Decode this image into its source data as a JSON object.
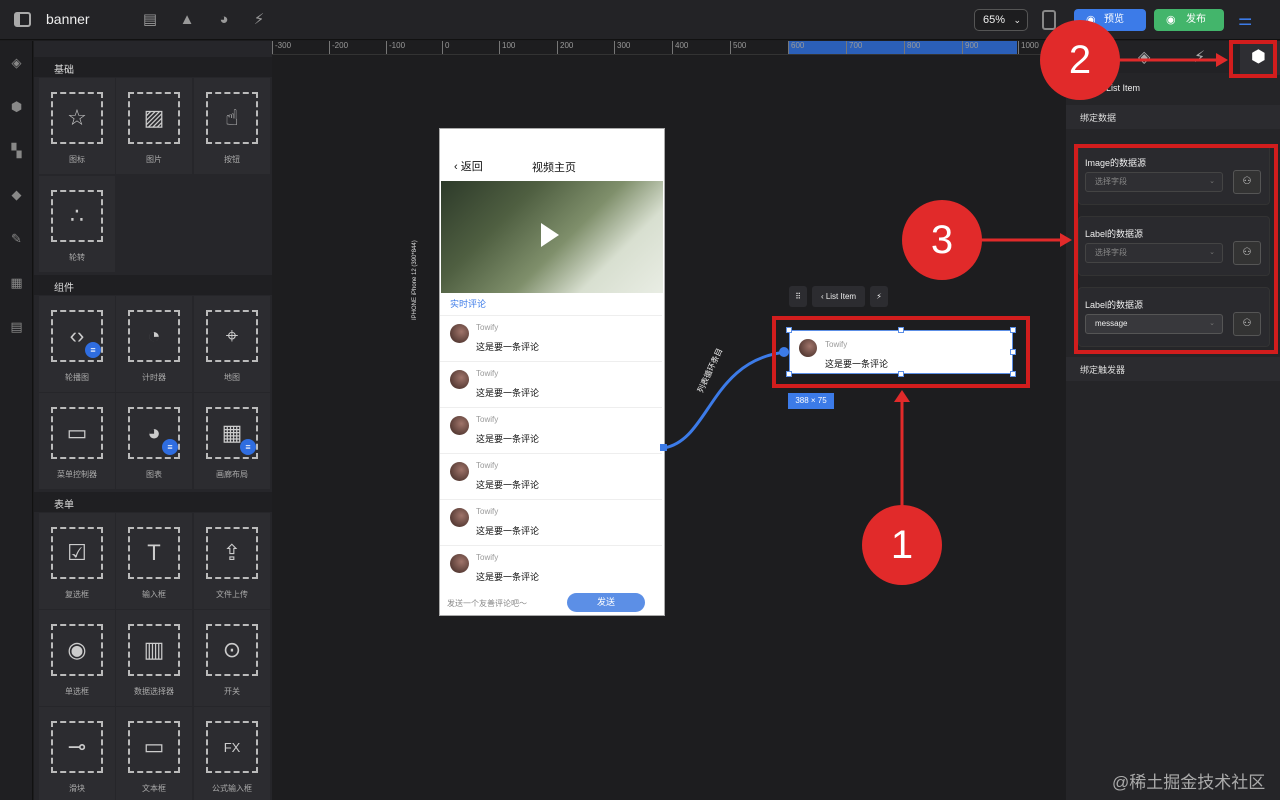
{
  "app": {
    "title": "banner",
    "zoom": "65%",
    "preview": "预览",
    "publish": "发布"
  },
  "panel": {
    "sections": [
      {
        "title": "基础",
        "items": [
          {
            "label": "图标",
            "icon": "star-icon"
          },
          {
            "label": "图片",
            "icon": "image-icon"
          },
          {
            "label": "按钮",
            "icon": "button-icon"
          },
          {
            "label": "轮转",
            "icon": "spinner-icon"
          }
        ]
      },
      {
        "title": "组件",
        "items": [
          {
            "label": "轮播图",
            "icon": "carousel-icon"
          },
          {
            "label": "计时器",
            "icon": "timer-icon"
          },
          {
            "label": "地图",
            "icon": "map-icon"
          },
          {
            "label": "菜单控制器",
            "icon": "menu-icon"
          },
          {
            "label": "图表",
            "icon": "chart-icon"
          },
          {
            "label": "画廊布局",
            "icon": "gallery-icon"
          }
        ]
      },
      {
        "title": "表单",
        "items": [
          {
            "label": "复选框",
            "icon": "checkbox-icon"
          },
          {
            "label": "输入框",
            "icon": "input-icon"
          },
          {
            "label": "文件上传",
            "icon": "upload-icon"
          },
          {
            "label": "单选框",
            "icon": "radio-icon"
          },
          {
            "label": "数据选择器",
            "icon": "picker-icon"
          },
          {
            "label": "开关",
            "icon": "switch-icon"
          },
          {
            "label": "滑块",
            "icon": "slider-icon"
          },
          {
            "label": "文本框",
            "icon": "textarea-icon"
          },
          {
            "label": "公式输入框",
            "icon": "formula-icon"
          }
        ]
      }
    ]
  },
  "ruler": [
    "-300",
    "-200",
    "-100",
    "0",
    "100",
    "200",
    "300",
    "400",
    "500",
    "600",
    "700",
    "800",
    "900",
    "1000"
  ],
  "phone": {
    "device": "IPHONE  iPhone 12 (390*844)",
    "back": "返回",
    "title": "视频主页",
    "comments_title": "实时评论",
    "comments": [
      {
        "name": "Towify",
        "text": "这是要一条评论"
      },
      {
        "name": "Towify",
        "text": "这是要一条评论"
      },
      {
        "name": "Towify",
        "text": "这是要一条评论"
      },
      {
        "name": "Towify",
        "text": "这是要一条评论"
      },
      {
        "name": "Towify",
        "text": "这是要一条评论"
      },
      {
        "name": "Towify",
        "text": "这是要一条评论"
      }
    ],
    "input_placeholder": "发送一个友善评论吧～",
    "send": "发送"
  },
  "connector_label": "列表循环条目",
  "selection": {
    "toolbar_label": "List Item",
    "name": "Towify",
    "text": "这是要一条评论",
    "size": "388 × 75"
  },
  "right_panel": {
    "title": "List Item",
    "bind_data": "绑定数据",
    "fields": [
      {
        "label": "Image的数据源",
        "value": "选择字段",
        "filled": false
      },
      {
        "label": "Label的数据源",
        "value": "选择字段",
        "filled": false
      },
      {
        "label": "Label的数据源",
        "value": "message",
        "filled": true
      }
    ],
    "bind_trigger": "绑定触发器"
  },
  "annotations": {
    "one": "1",
    "two": "2",
    "three": "3",
    "accent": "#e12a2a"
  },
  "watermark": "@稀土掘金技术社区"
}
